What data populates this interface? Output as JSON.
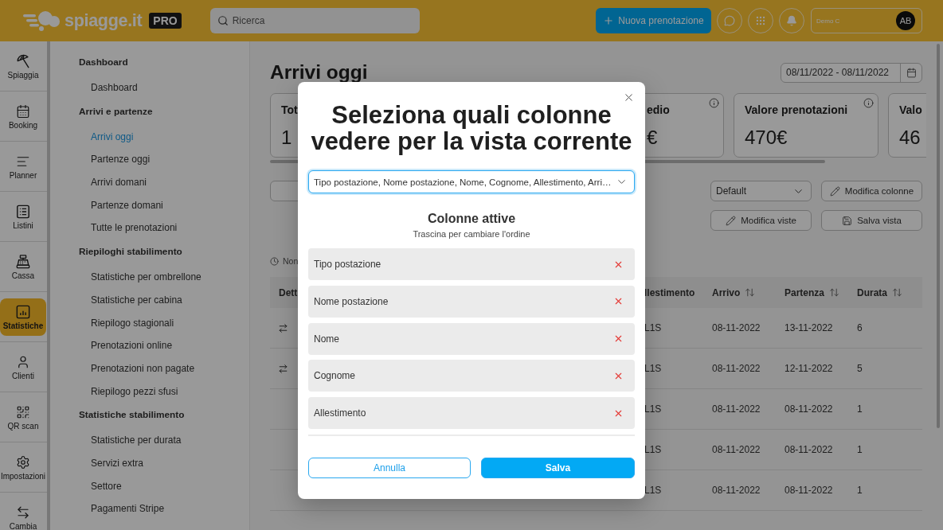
{
  "header": {
    "logo": "spiagge.it",
    "badge": "PRO",
    "search": {
      "placeholder": "Ricerca"
    },
    "new_booking": "Nuova prenotazione",
    "account": {
      "name": "Demo C",
      "initials": "AB"
    }
  },
  "rail": [
    {
      "label": "Spiaggia",
      "selected": false
    },
    {
      "label": "Booking",
      "selected": false
    },
    {
      "label": "Planner",
      "selected": false
    },
    {
      "label": "Listini",
      "selected": false
    },
    {
      "label": "Cassa",
      "selected": false
    },
    {
      "label": "Statistiche",
      "selected": true
    },
    {
      "label": "Clienti",
      "selected": false
    },
    {
      "label": "QR scan",
      "selected": false
    },
    {
      "label": "Impostazioni",
      "selected": false
    },
    {
      "label": "Cambia",
      "selected": false
    }
  ],
  "menu": [
    {
      "heading": "Dashboard",
      "items": [
        {
          "label": "Dashboard",
          "selected": false
        }
      ]
    },
    {
      "heading": "Arrivi e partenze",
      "items": [
        {
          "label": "Arrivi oggi",
          "selected": true
        },
        {
          "label": "Partenze oggi",
          "selected": false
        },
        {
          "label": "Arrivi domani",
          "selected": false
        },
        {
          "label": "Partenze domani",
          "selected": false
        },
        {
          "label": "Tutte le prenotazioni",
          "selected": false
        }
      ]
    },
    {
      "heading": "Riepiloghi stabilimento",
      "items": [
        {
          "label": "Statistiche per ombrellone",
          "selected": false
        },
        {
          "label": "Statistiche per cabina",
          "selected": false
        },
        {
          "label": "Riepilogo stagionali",
          "selected": false
        },
        {
          "label": "Prenotazioni online",
          "selected": false
        },
        {
          "label": "Prenotazioni non pagate",
          "selected": false
        },
        {
          "label": "Riepilogo pezzi sfusi",
          "selected": false
        }
      ]
    },
    {
      "heading": "Statistiche stabilimento",
      "items": [
        {
          "label": "Statistiche per durata",
          "selected": false
        },
        {
          "label": "Servizi extra",
          "selected": false
        },
        {
          "label": "Settore",
          "selected": false
        },
        {
          "label": "Pagamenti Stripe",
          "selected": false
        }
      ]
    }
  ],
  "page": {
    "title": "Arrivi oggi",
    "date_range": "08/11/2022 - 08/11/2022",
    "cards": [
      {
        "title": "Tot",
        "value": "1"
      },
      {
        "title": "edio",
        "value": "€",
        "info": true
      },
      {
        "title": "Valore prenotazioni",
        "value": "470€",
        "info": true
      },
      {
        "title": "Valo",
        "value": "46"
      }
    ],
    "view_select": "Default",
    "buttons": [
      "Modifica colonne",
      "Modifica viste",
      "Salva vista"
    ],
    "status": "Non",
    "table": {
      "columns": [
        {
          "label": "Dett"
        },
        {
          "label": "llestimento",
          "sortable": false
        },
        {
          "label": "Arrivo",
          "sortable": true
        },
        {
          "label": "Partenza",
          "sortable": true
        },
        {
          "label": "Durata",
          "sortable": true
        }
      ],
      "rows": [
        {
          "transfer": true,
          "cells": [
            "",
            "L1S",
            "08-11-2022",
            "13-11-2022",
            "6"
          ]
        },
        {
          "transfer": true,
          "cells": [
            "",
            "L1S",
            "08-11-2022",
            "12-11-2022",
            "5"
          ]
        },
        {
          "transfer": false,
          "cells": [
            "",
            "L1S",
            "08-11-2022",
            "08-11-2022",
            "1"
          ]
        },
        {
          "transfer": false,
          "cells": [
            "",
            "L1S",
            "08-11-2022",
            "08-11-2022",
            "1"
          ]
        },
        {
          "transfer": false,
          "cells": [
            "",
            "L1S",
            "08-11-2022",
            "08-11-2022",
            "1"
          ]
        }
      ]
    }
  },
  "modal": {
    "title": "Seleziona quali colonne vedere per la vista corrente",
    "select_value": "Tipo postazione, Nome postazione, Nome, Cognome, Allestimento, Arri…",
    "section_title": "Colonne attive",
    "section_hint": "Trascina per cambiare l'ordine",
    "active_columns": [
      "Tipo postazione",
      "Nome postazione",
      "Nome",
      "Cognome",
      "Allestimento"
    ],
    "cancel": "Annulla",
    "save": "Salva"
  }
}
